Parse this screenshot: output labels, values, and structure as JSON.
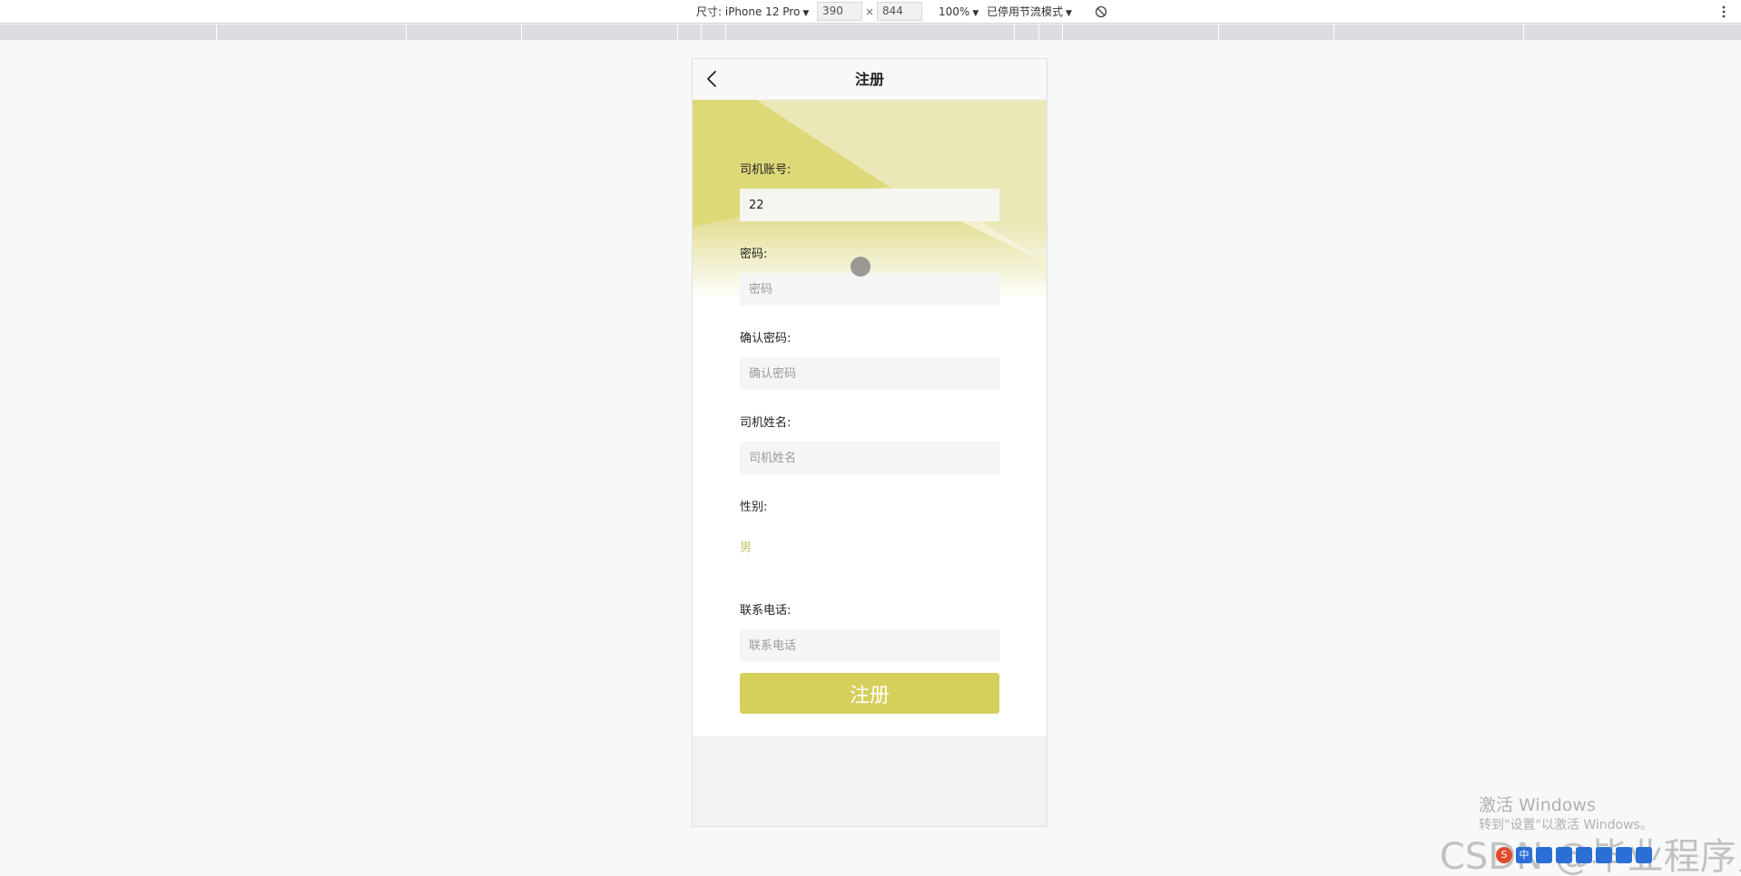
{
  "devtools": {
    "device_label": "尺寸: iPhone 12 Pro",
    "width": "390",
    "times": "×",
    "height": "844",
    "zoom": "100%",
    "throttle": "已停用节流模式"
  },
  "nav": {
    "title": "注册",
    "back_icon": "chevron-left-icon"
  },
  "form": {
    "account_label": "司机账号:",
    "account_value": "22",
    "password_label": "密码:",
    "password_placeholder": "密码",
    "confirm_label": "确认密码:",
    "confirm_placeholder": "确认密码",
    "name_label": "司机姓名:",
    "name_placeholder": "司机姓名",
    "gender_label": "性别:",
    "gender_value": "男",
    "phone_label": "联系电话:",
    "phone_placeholder": "联系电话",
    "submit_label": "注册"
  },
  "colors": {
    "accent": "#d5cf5c",
    "gender_text": "#c9c46a"
  },
  "watermark": {
    "activate_title": "激活 Windows",
    "activate_sub": "转到\"设置\"以激活 Windows。",
    "csdn": "CSDN @毕业程序员"
  },
  "tray_first_glyph": "S",
  "tray_ime": "中"
}
